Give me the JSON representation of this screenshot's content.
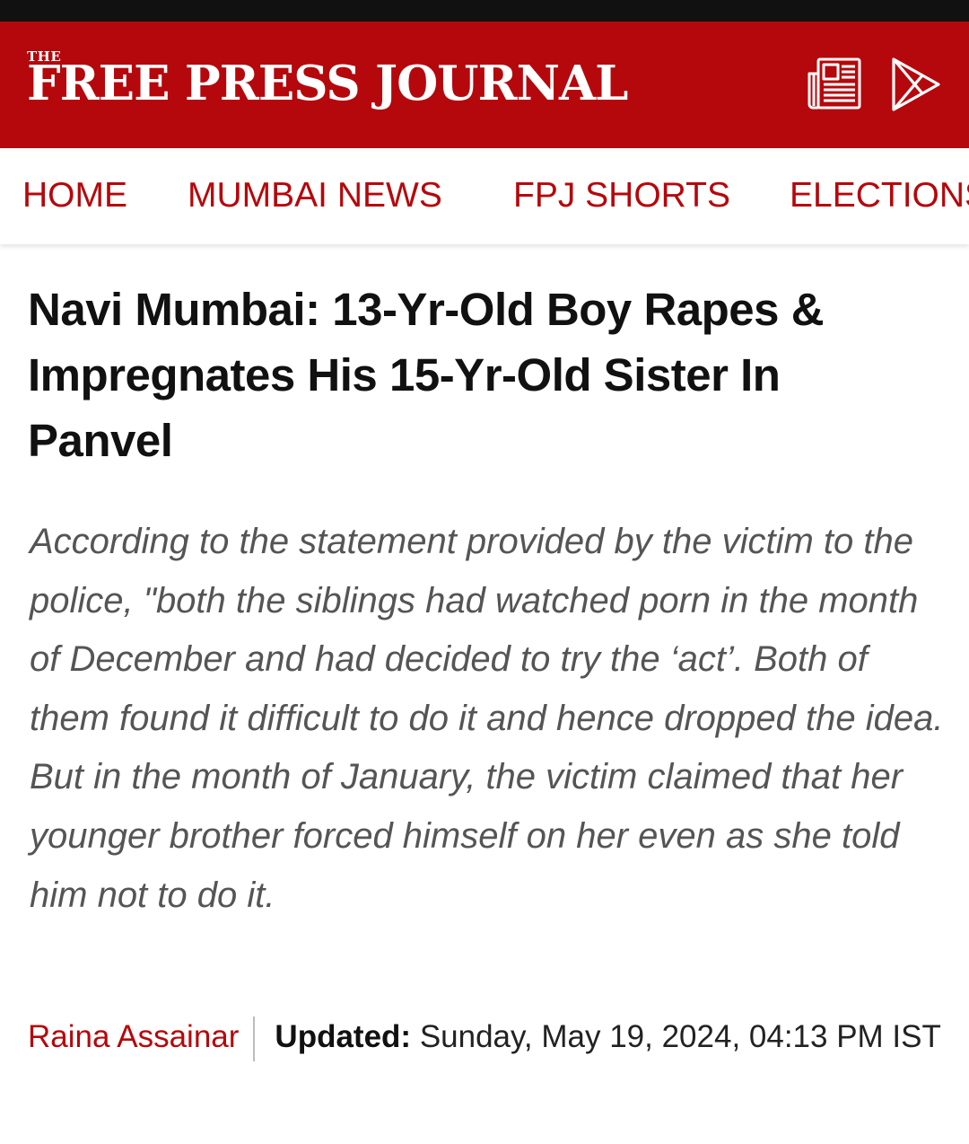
{
  "header": {
    "logo_the": "THE",
    "logo_name": "FREE PRESS JOURNAL",
    "epaper_icon": "newspaper-icon",
    "play_icon": "play-store-icon",
    "brand_color": "#b5080c"
  },
  "nav": {
    "items": [
      {
        "label": "HOME"
      },
      {
        "label": "MUMBAI NEWS"
      },
      {
        "label": "FPJ SHORTS"
      },
      {
        "label": "ELECTIONS"
      }
    ]
  },
  "article": {
    "headline": "Navi Mumbai: 13-Yr-Old Boy Rapes & Impregnates His 15-Yr-Old Sister In Panvel",
    "summary": "According to the statement provided by the victim to the police, \"both the siblings had watched porn in the month of December and had decided to try the ‘act’. Both of them found it difficult to do it and hence dropped the idea. But in the month of January, the victim claimed that her younger brother forced himself on her even as she told him not to do it.",
    "author": "Raina Assainar",
    "updated_label": "Updated:",
    "updated_value": "Sunday, May 19, 2024, 04:13 PM IST"
  }
}
